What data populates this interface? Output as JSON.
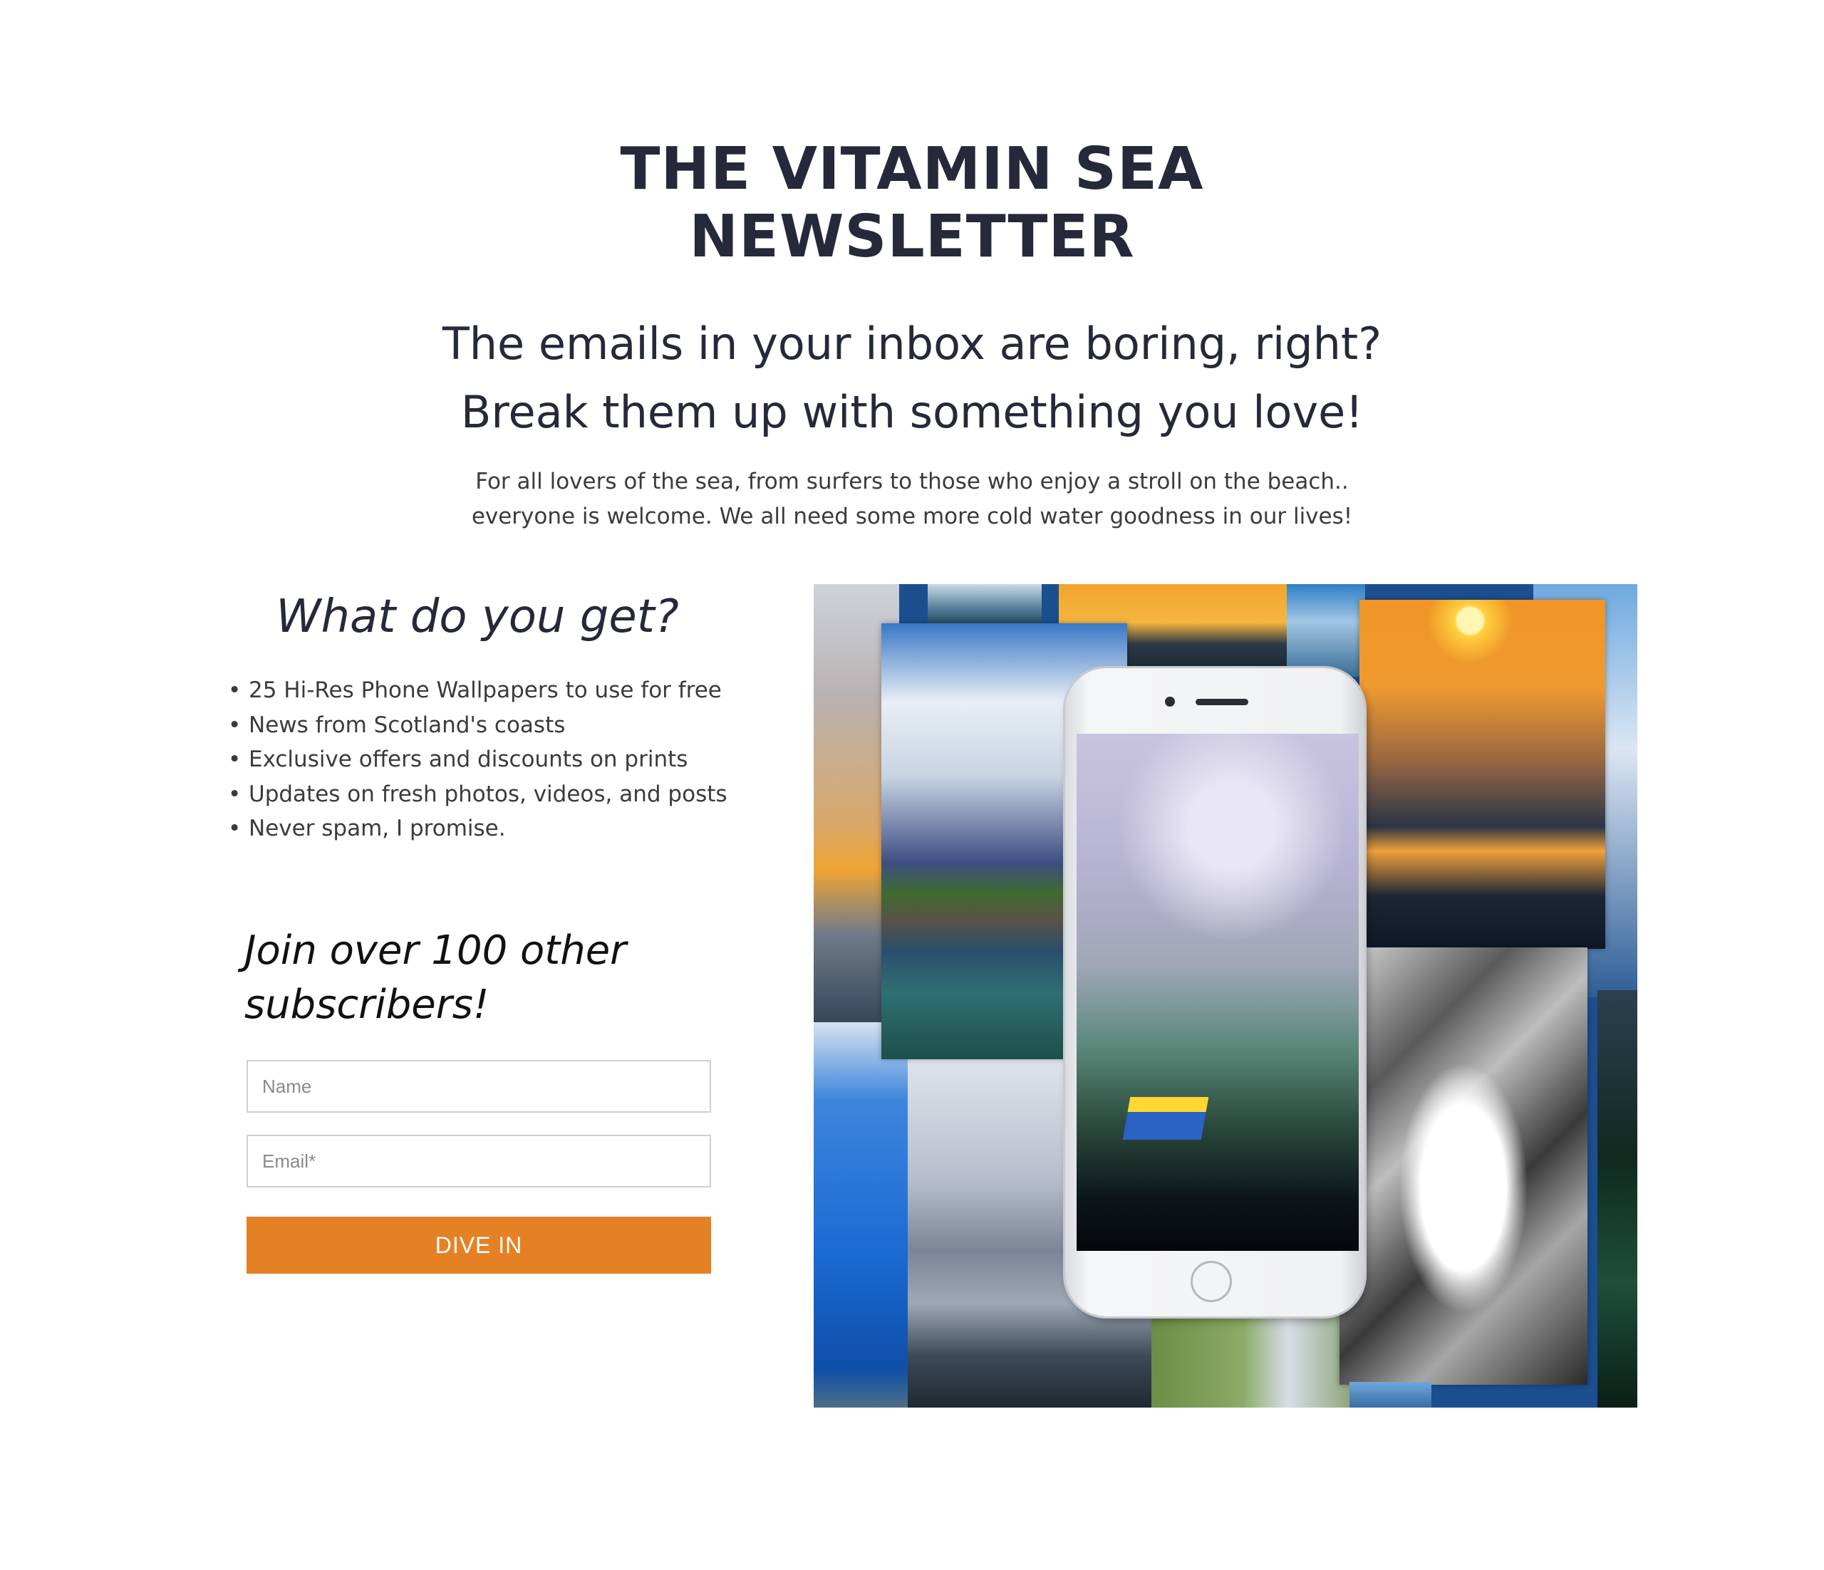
{
  "header": {
    "title_line1": "THE VITAMIN SEA",
    "title_line2": "NEWSLETTER",
    "subtitle_line1": "The emails in your inbox are boring, right?",
    "subtitle_line2": "Break them up with something you love!",
    "intro": "For all lovers of the sea, from surfers to those who enjoy a stroll on the beach.. everyone is welcome. We all need some more cold water goodness in our lives!"
  },
  "benefits": {
    "heading": "What do you get?",
    "items": [
      "25 Hi-Res Phone Wallpapers to use for free",
      "News from Scotland's coasts",
      "Exclusive offers and discounts on prints",
      "Updates on fresh photos, videos, and posts",
      "Never spam, I promise."
    ]
  },
  "signup": {
    "heading": "Join over 100 other subscribers!",
    "name_placeholder": "Name",
    "email_placeholder": "Email*",
    "button_label": "DIVE IN"
  },
  "colors": {
    "text_dark": "#252939",
    "button_bg": "#e58125",
    "button_text": "#ffffff"
  }
}
